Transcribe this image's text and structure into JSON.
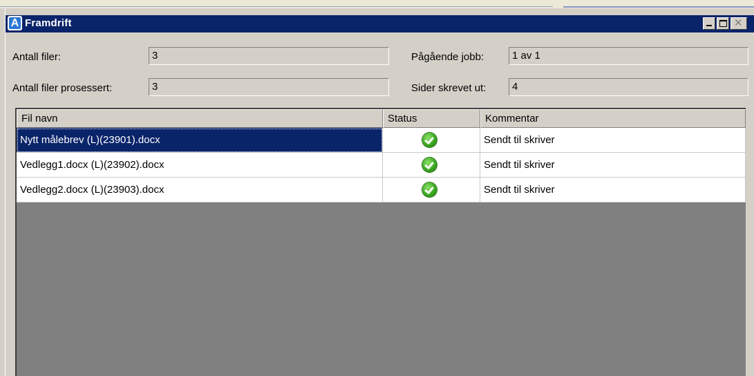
{
  "window": {
    "title": "Framdrift",
    "app_icon_letter": "A"
  },
  "fields": {
    "antall_filer_label": "Antall filer:",
    "antall_filer_value": "3",
    "antall_prosessert_label": "Antall filer prosessert:",
    "antall_prosessert_value": "3",
    "pagaende_jobb_label": "Pågående jobb:",
    "pagaende_jobb_value": "1 av 1",
    "sider_label": "Sider skrevet ut:",
    "sider_value": "4"
  },
  "table": {
    "columns": [
      "Fil navn",
      "Status",
      "Kommentar"
    ],
    "rows": [
      {
        "file": "Nytt målebrev (L)(23901).docx",
        "status_icon": "check-ok-icon",
        "comment": "Sendt til skriver",
        "selected": true
      },
      {
        "file": "Vedlegg1.docx (L)(23902).docx",
        "status_icon": "check-ok-icon",
        "comment": "Sendt til skriver",
        "selected": false
      },
      {
        "file": "Vedlegg2.docx (L)(23903).docx",
        "status_icon": "check-ok-icon",
        "comment": "Sendt til skriver",
        "selected": false
      }
    ]
  },
  "colors": {
    "titlebar": "#0a246a",
    "selection": "#0a246a",
    "status_ok": "#3aa820",
    "grid_background": "#808080"
  }
}
